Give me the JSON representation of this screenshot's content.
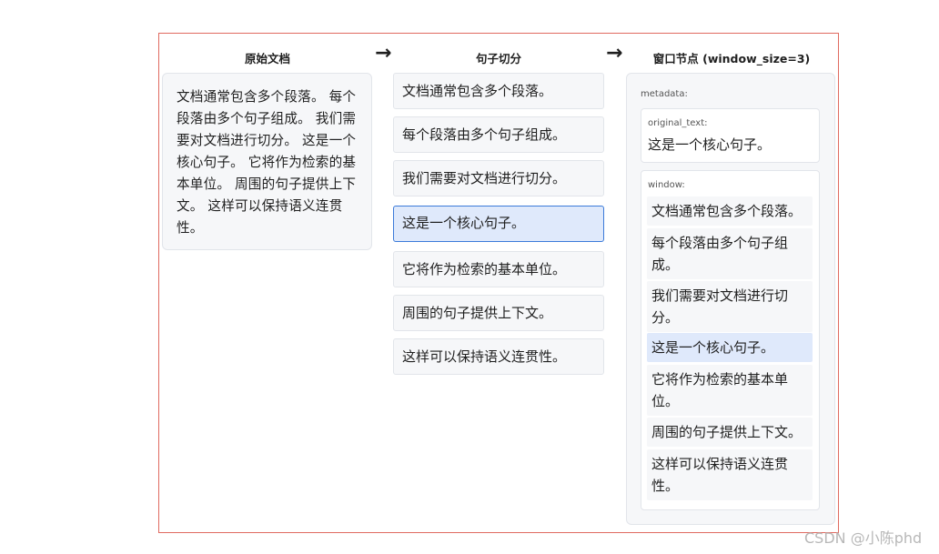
{
  "headings": {
    "source": "原始文档",
    "sentences": "句子切分",
    "window_node": "窗口节点 (window_size=3)"
  },
  "source_text": "文档通常包含多个段落。 每个段落由多个句子组成。 我们需要对文档进行切分。 这是一个核心句子。 它将作为检索的基本单位。 周围的句子提供上下文。 这样可以保持语义连贯性。",
  "sentences": [
    "文档通常包含多个段落。",
    "每个段落由多个句子组成。",
    "我们需要对文档进行切分。",
    "这是一个核心句子。",
    "它将作为检索的基本单位。",
    "周围的句子提供上下文。",
    "这样可以保持语义连贯性。"
  ],
  "metadata": {
    "label": "metadata:",
    "original_text_label": "original_text:",
    "original_text": "这是一个核心句子。",
    "window_label": "window:",
    "window": [
      "文档通常包含多个段落。",
      "每个段落由多个句子组成。",
      "我们需要对文档进行切分。",
      "这是一个核心句子。",
      "它将作为检索的基本单位。",
      "周围的句子提供上下文。",
      "这样可以保持语义连贯性。"
    ]
  },
  "active_index": 3,
  "watermark": "CSDN @小陈phd",
  "colors": {
    "frame_border": "#e06a60",
    "highlight_fill": "#dfe9fb",
    "highlight_border": "#3b7ad9",
    "box_fill": "#f6f7f9"
  }
}
